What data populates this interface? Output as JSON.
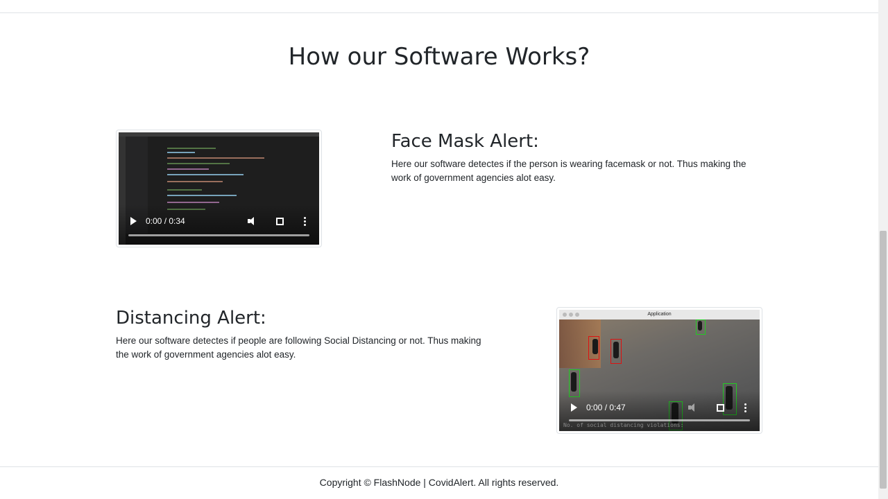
{
  "page": {
    "heading": "How our Software Works?",
    "footer": "Copyright © FlashNode | CovidAlert. All rights reserved."
  },
  "sections": [
    {
      "title": "Face Mask Alert:",
      "text": "Here our software detectes if the person is wearing facemask or not. Thus making the work of government agencies alot easy.",
      "video": {
        "time": "0:00 / 0:34"
      }
    },
    {
      "title": "Distancing Alert:",
      "text": "Here our software detectes if people are following Social Distancing or not. Thus making the work of government agencies alot easy.",
      "video": {
        "time": "0:00 / 0:47",
        "window_title": "Application",
        "overlay": "No. of social distancing violations:"
      }
    }
  ],
  "colors": {
    "text": "#212529",
    "border": "#dee2e6",
    "safe_box": "#22cc22",
    "violation_box": "#dd1111"
  }
}
